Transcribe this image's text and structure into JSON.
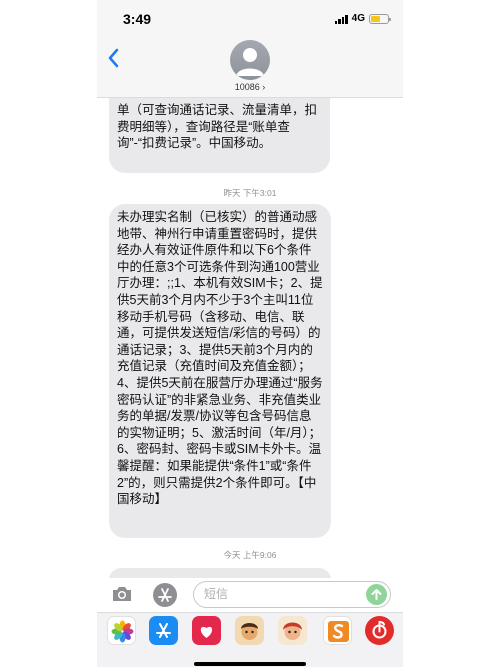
{
  "status_bar": {
    "time": "3:49",
    "network": "4G"
  },
  "header": {
    "back_icon": "chevron-left-icon",
    "contact_label": "10086 ›"
  },
  "messages": [
    {
      "text": "单（可查询通话记录、流量清单，扣费明细等），查询路径是“账单查询”-“扣费记录”。中国移动。"
    },
    {
      "timestamp": "昨天 下午3:01",
      "text": "未办理实名制（已核实）的普通动感地带、神州行申请重置密码时，提供经办人有效证件原件和以下6个条件中的任意3个可选条件到沟通100营业厅办理：;;1、本机有效SIM卡；2、提供5天前3个月内不少于3个主叫11位移动手机号码（含移动、电信、联通，可提供发送短信/彩信的号码）的通话记录；3、提供5天前3个月内的充值记录（充值时间及充值金额）；4、提供5天前在服营厅办理通过“服务密码认证”的非紧急业务、非充值类业务的单据/发票/协议等包含号码信息的实物证明；5、激活时间（年/月）；6、密码封、密码卡或SIM卡外卡。温馨提醒：如果能提供“条件1”或“条件2”的，则只需提供2个条件即可。【中国移动】"
    },
    {
      "timestamp": "今天 上午9:06",
      "text": ""
    }
  ],
  "input": {
    "placeholder": "短信",
    "camera_icon": "camera-icon",
    "apps_icon": "app-store-icon",
    "send_icon": "arrow-up-icon"
  },
  "app_drawer": {
    "apps": [
      "photos-app-icon",
      "app-store-app-icon",
      "heart-app-icon",
      "memoji-app-icon",
      "memoji-app-icon",
      "sohu-app-icon",
      "netease-music-app-icon"
    ]
  },
  "colors": {
    "accent": "#1a7cf5",
    "bubble_gray": "#e9e9eb",
    "battery": "#f5c518"
  }
}
